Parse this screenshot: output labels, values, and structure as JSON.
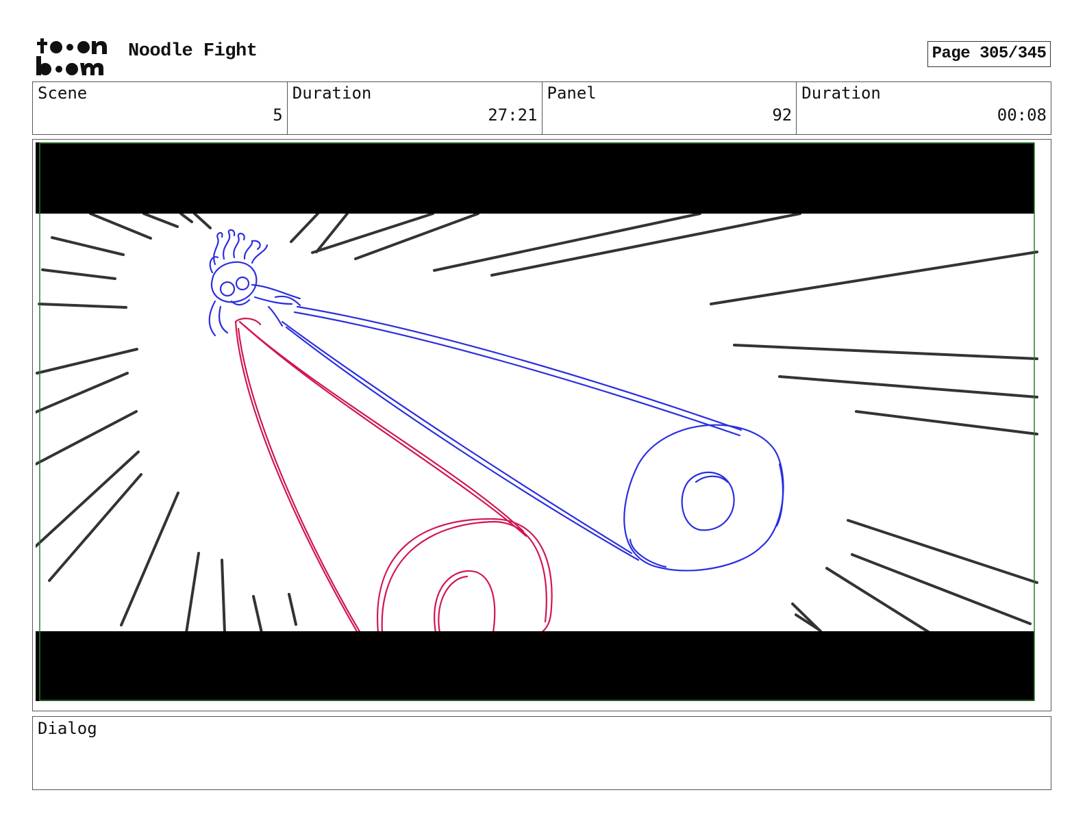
{
  "header": {
    "logo_text": "toon boom",
    "project_title": "Noodle Fight",
    "page_indicator": "Page 305/345"
  },
  "info": {
    "scene_label": "Scene",
    "scene_value": "5",
    "scene_duration_label": "Duration",
    "scene_duration_value": "27:21",
    "panel_label": "Panel",
    "panel_value": "92",
    "panel_duration_label": "Duration",
    "panel_duration_value": "00:08"
  },
  "dialog": {
    "label": "Dialog",
    "text": ""
  },
  "colors": {
    "character_blue": "#2a2ee0",
    "character_red": "#d0164f",
    "speed_lines": "#333333",
    "frame_green": "#2f7a2f",
    "letterbox": "#000000"
  }
}
